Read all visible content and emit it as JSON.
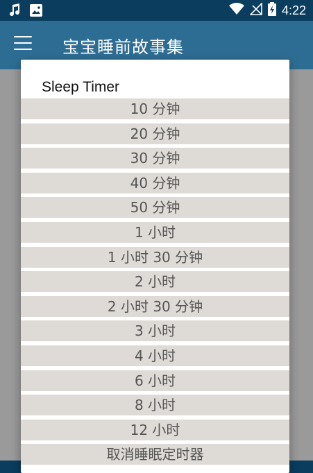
{
  "status_bar": {
    "time": "4:22",
    "left_icons": [
      "music-note-icon",
      "image-icon"
    ],
    "right_icons": [
      "wifi-icon",
      "no-signal-icon",
      "battery-charging-icon"
    ]
  },
  "app_bar": {
    "title": "宝宝睡前故事集",
    "menu_icon": "hamburger-menu-icon"
  },
  "dialog": {
    "title": "Sleep Timer",
    "options": [
      "10 分钟",
      "20 分钟",
      "30 分钟",
      "40 分钟",
      "50 分钟",
      "1 小时",
      "1 小时 30 分钟",
      "2 小时",
      "2 小时 30 分钟",
      "3 小时",
      "4 小时",
      "6 小时",
      "8 小时",
      "12 小时",
      "取消睡眠定时器"
    ]
  },
  "colors": {
    "status_bar": "#0a3d5e",
    "app_bar": "#2e6d93",
    "option_bg": "#dedad5",
    "option_text": "#555555"
  }
}
